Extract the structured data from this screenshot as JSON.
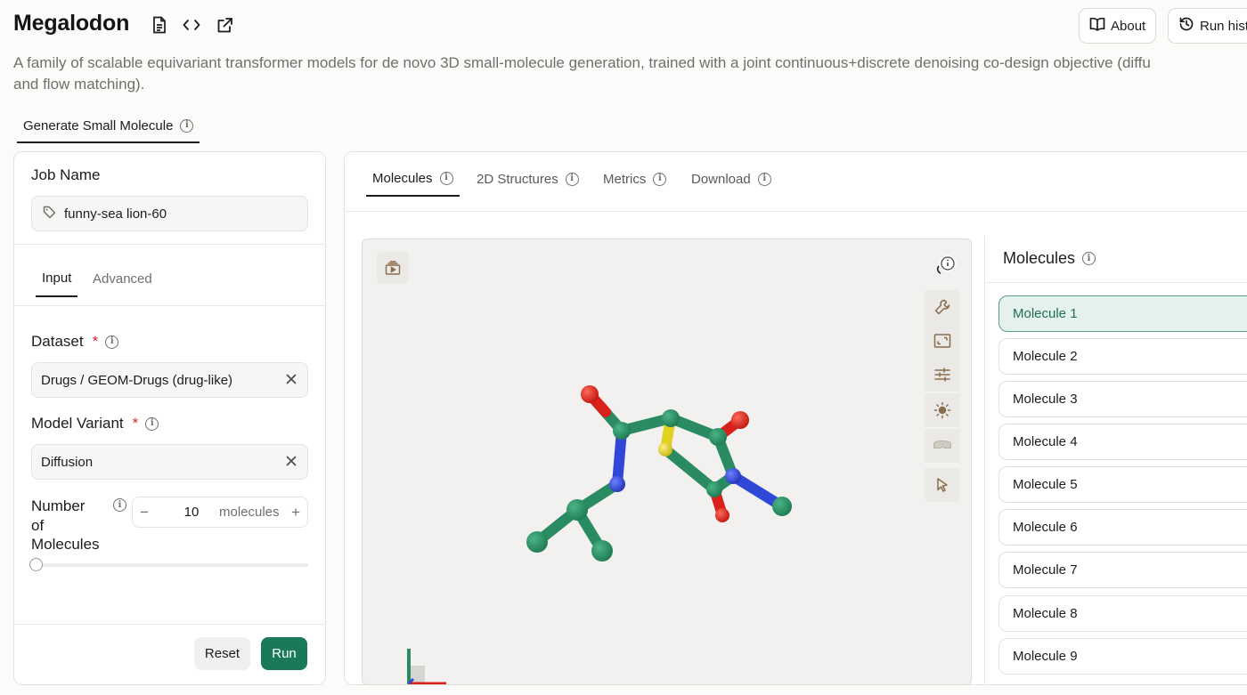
{
  "header": {
    "title": "Megalodon",
    "icons": [
      "document-icon",
      "code-icon",
      "external-link-icon"
    ],
    "about_label": "About",
    "run_history_label": "Run hist",
    "description_line1": "A family of scalable equivariant transformer models for de novo 3D small-molecule generation, trained with a joint continuous+discrete denoising co-design objective (diffu",
    "description_line2": "and flow matching)."
  },
  "main_tab": {
    "label": "Generate Small Molecule"
  },
  "form": {
    "job_name_label": "Job Name",
    "job_name_value": "funny-sea lion-60",
    "tabs": [
      "Input",
      "Advanced"
    ],
    "active_tab": "Input",
    "dataset_label": "Dataset",
    "dataset_value": "Drugs / GEOM-Drugs (drug-like)",
    "model_variant_label": "Model Variant",
    "model_variant_value": "Diffusion",
    "required_mark": "*",
    "num_molecules_label_1": "Number",
    "num_molecules_label_2": "of",
    "num_molecules_label_3": "Molecules",
    "num_molecules_value": "10",
    "num_molecules_unit": "molecules",
    "minus": "−",
    "plus": "+",
    "slider_fraction": 0.0,
    "reset_label": "Reset",
    "run_label": "Run"
  },
  "results": {
    "tabs": [
      "Molecules",
      "2D Structures",
      "Metrics",
      "Download"
    ],
    "active_tab": "Molecules",
    "viewer_tools": [
      "play-icon",
      "spinner-icon",
      "wrench-icon",
      "screenshot-icon",
      "sliders-icon",
      "sun-icon",
      "glasses-icon",
      "cursor-icon"
    ],
    "molecules_title": "Molecules",
    "molecules": [
      "Molecule 1",
      "Molecule 2",
      "Molecule 3",
      "Molecule 4",
      "Molecule 5",
      "Molecule 6",
      "Molecule 7",
      "Molecule 8",
      "Molecule 9"
    ],
    "selected_molecule": "Molecule 1"
  },
  "colors": {
    "accent": "#1a7a57",
    "carbon": "#2a8b62",
    "oxygen": "#d9201a",
    "nitrogen": "#2f48d8",
    "sulfur": "#e0d21f",
    "required": "#d6262b"
  }
}
